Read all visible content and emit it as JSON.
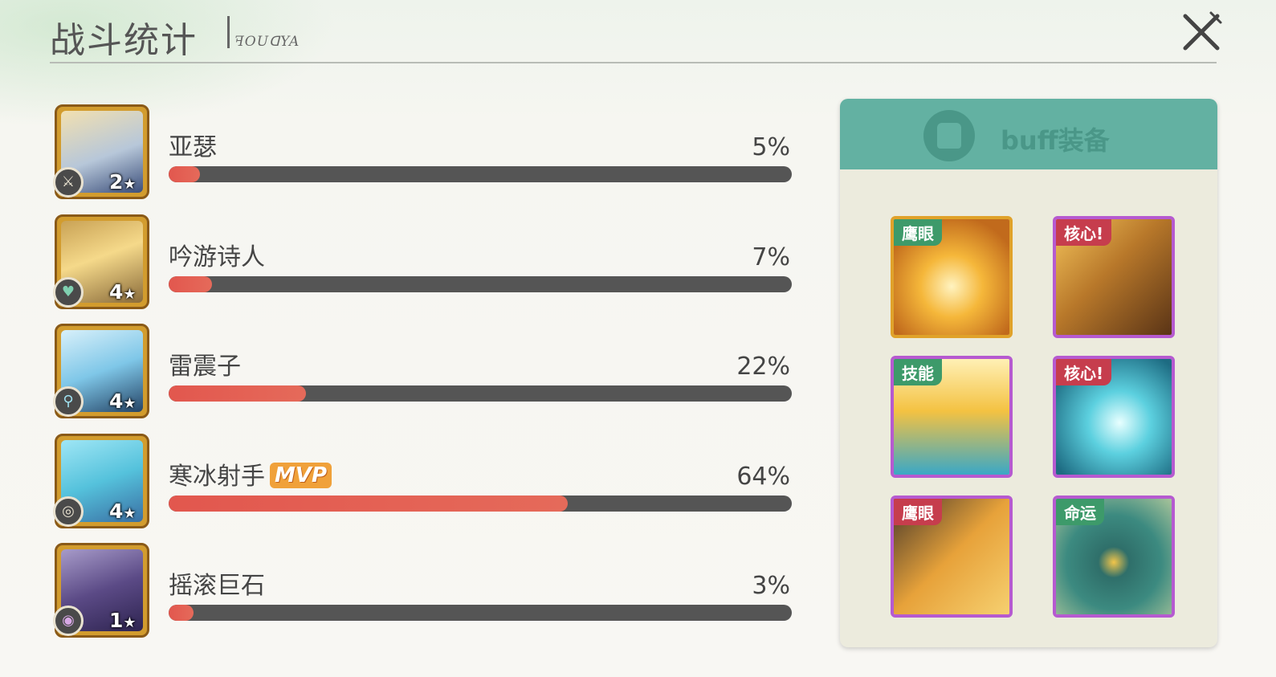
{
  "header": {
    "title": "战斗统计",
    "subtitle": "ꟻOUꓷYA"
  },
  "heroes": [
    {
      "name": "亚瑟",
      "percent_label": "5%",
      "percent": 5,
      "stars": "2",
      "class_icon": "sword-icon",
      "mvp": ""
    },
    {
      "name": "吟游诗人",
      "percent_label": "7%",
      "percent": 7,
      "stars": "4",
      "class_icon": "heart-icon",
      "mvp": ""
    },
    {
      "name": "雷震子",
      "percent_label": "22%",
      "percent": 22,
      "stars": "4",
      "class_icon": "staff-icon",
      "mvp": ""
    },
    {
      "name": "寒冰射手",
      "percent_label": "64%",
      "percent": 64,
      "stars": "4",
      "class_icon": "target-icon",
      "mvp": "MVP"
    },
    {
      "name": "摇滚巨石",
      "percent_label": "3%",
      "percent": 3,
      "stars": "1",
      "class_icon": "shield-icon",
      "mvp": ""
    }
  ],
  "buff_panel": {
    "title": "buff装备",
    "icon": "armor-icon",
    "cards": [
      {
        "tag": "鹰眼",
        "rarity": "gold"
      },
      {
        "tag": "核心!",
        "rarity": "purple"
      },
      {
        "tag": "技能",
        "rarity": "purple"
      },
      {
        "tag": "核心!",
        "rarity": "purple"
      },
      {
        "tag": "鹰眼",
        "rarity": "purple"
      },
      {
        "tag": "命运",
        "rarity": "purple"
      }
    ]
  },
  "colors": {
    "bar_fill": "#e2574e",
    "bar_track": "#555555",
    "panel_header": "#63b1a2",
    "mvp": "#f0a13a"
  }
}
